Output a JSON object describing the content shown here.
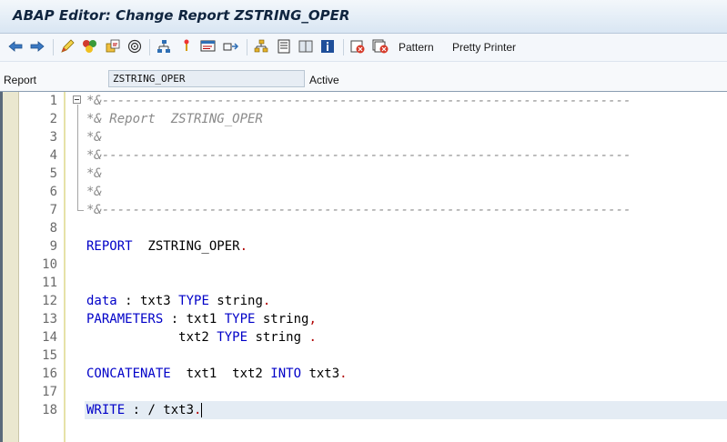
{
  "window": {
    "title": "ABAP Editor: Change Report ZSTRING_OPER"
  },
  "toolbar": {
    "icons": [
      "back-arrow-icon",
      "forward-arrow-icon",
      "other-object-icon",
      "display-change-icon",
      "activate-icon",
      "check-icon",
      "test-run-icon",
      "where-used-icon",
      "navigate-icon",
      "syntax-check-icon",
      "object-list-icon",
      "display-object-list-icon",
      "hierarchy-icon",
      "split-screen-icon",
      "help-icon",
      "info-icon",
      "delete-icon",
      "delete-all-icon"
    ],
    "pattern_label": "Pattern",
    "pretty_printer_label": "Pretty Printer"
  },
  "info_bar": {
    "report_label": "Report",
    "report_value": "ZSTRING_OPER",
    "status": "Active"
  },
  "editor": {
    "line_numbers": [
      "1",
      "2",
      "3",
      "4",
      "5",
      "6",
      "7",
      "8",
      "9",
      "10",
      "11",
      "12",
      "13",
      "14",
      "15",
      "16",
      "17",
      "18"
    ],
    "lines": {
      "l1": "*&---------------------------------------------------------------------",
      "l2": "*& Report  ZSTRING_OPER",
      "l3": "*&",
      "l4": "*&---------------------------------------------------------------------",
      "l5": "*&",
      "l6": "*&",
      "l7": "*&---------------------------------------------------------------------",
      "l9": {
        "kw1": "REPORT",
        "rest": "  ZSTRING_OPER",
        "end": "."
      },
      "l12": {
        "kw1": "data",
        "p1": " : txt3 ",
        "kw2": "TYPE",
        "p2": " string",
        "end": "."
      },
      "l13": {
        "kw1": "PARAMETERS",
        "p1": " : txt1 ",
        "kw2": "TYPE",
        "p2": " string",
        "end": ","
      },
      "l14": {
        "p0": "            txt2 ",
        "kw2": "TYPE",
        "p2": " string ",
        "end": "."
      },
      "l16": {
        "kw1": "CONCATENATE",
        "p1": "  txt1  txt2 ",
        "kw2": "INTO",
        "p2": " txt3",
        "end": "."
      },
      "l18": {
        "kw1": "WRITE",
        "p1": " : / txt3",
        "end": "."
      }
    }
  }
}
